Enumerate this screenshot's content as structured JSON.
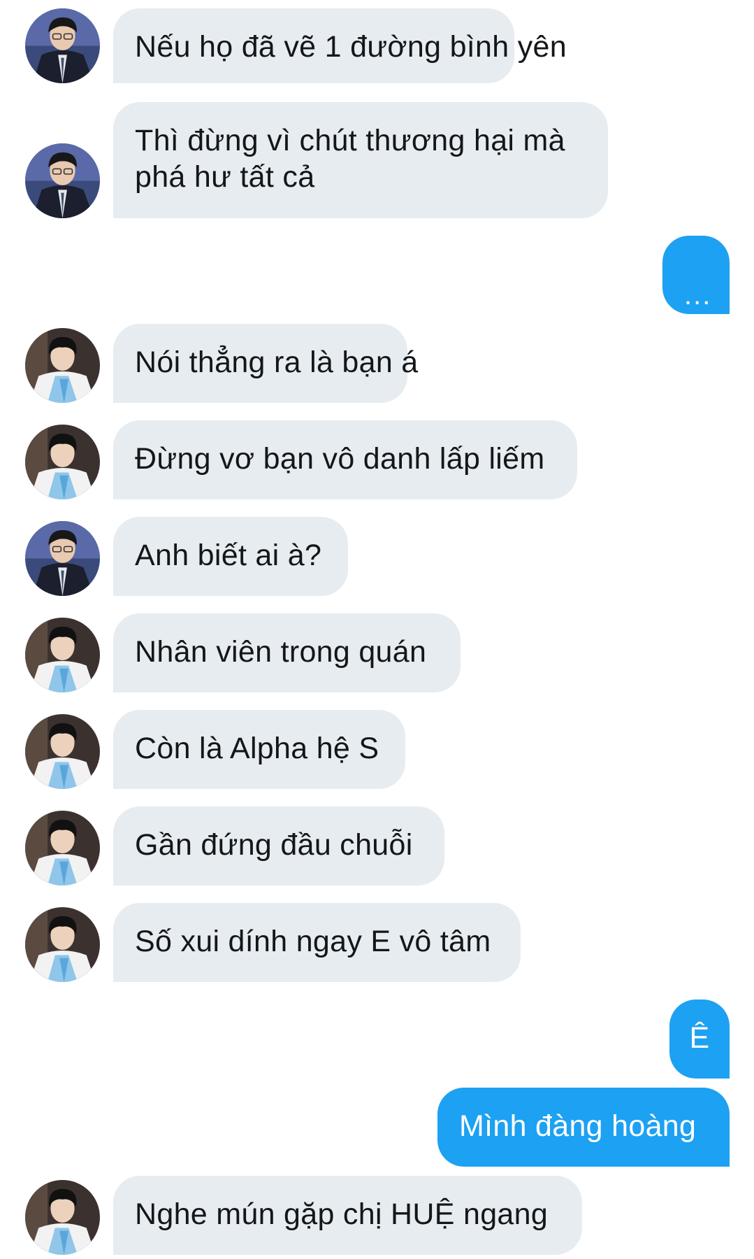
{
  "conversation": {
    "messages": [
      {
        "sender": "them",
        "avatar": "avatar-suit",
        "text": "Nếu họ đã vẽ 1 đường bình yên"
      },
      {
        "sender": "them",
        "avatar": "avatar-suit",
        "text": "Thì đừng vì chút thương hại mà phá hư tất cả"
      },
      {
        "sender": "me",
        "text": "..."
      },
      {
        "sender": "them",
        "avatar": "avatar-hanbok",
        "text": "Nói thẳng ra là bạn á"
      },
      {
        "sender": "them",
        "avatar": "avatar-hanbok",
        "text": "Đừng vơ bạn vô danh lấp liếm"
      },
      {
        "sender": "them",
        "avatar": "avatar-suit",
        "text": "Anh biết ai à?"
      },
      {
        "sender": "them",
        "avatar": "avatar-hanbok",
        "text": "Nhân viên trong quán"
      },
      {
        "sender": "them",
        "avatar": "avatar-hanbok",
        "text": "Còn là Alpha hệ S"
      },
      {
        "sender": "them",
        "avatar": "avatar-hanbok",
        "text": "Gần đứng đầu chuỗi"
      },
      {
        "sender": "them",
        "avatar": "avatar-hanbok",
        "text": "Số xui dính ngay E vô tâm"
      },
      {
        "sender": "me",
        "text": "Ê"
      },
      {
        "sender": "me",
        "text": "Mình đàng hoàng"
      },
      {
        "sender": "them",
        "avatar": "avatar-hanbok",
        "text": "Nghe mún gặp chị HUỆ ngang"
      }
    ]
  },
  "theme": {
    "incoming_bubble_color": "#e6ecf0",
    "outgoing_bubble_color": "#1da1f2",
    "incoming_text_color": "#14171a",
    "outgoing_text_color": "#ffffff"
  }
}
